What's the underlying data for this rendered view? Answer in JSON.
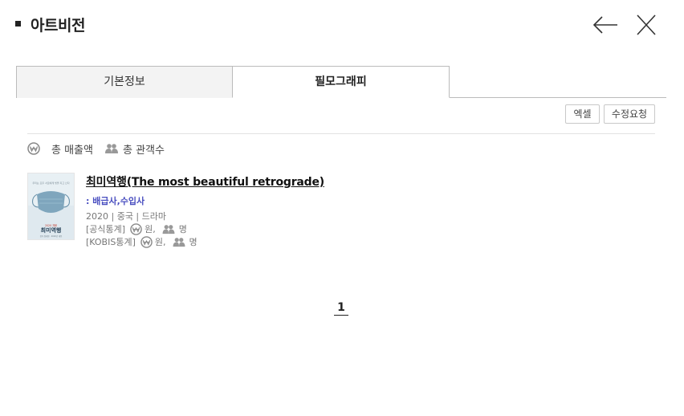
{
  "header": {
    "title": "아트비전"
  },
  "tabs": [
    {
      "label": "기본정보",
      "active": false
    },
    {
      "label": "필모그래피",
      "active": true
    }
  ],
  "toolbar": {
    "excel_label": "엑셀",
    "edit_request_label": "수정요청"
  },
  "summary": {
    "total_sales_label": "총 매출액",
    "total_audience_label": "총 관객수"
  },
  "films": [
    {
      "title": "최미역행(The most beautiful retrograde)",
      "company_role": ": 배급사,수입사",
      "meta": "2020 | 중국 | 드라마",
      "official_label": "[공식통계]",
      "kobis_label": "[KOBIS통계]",
      "won_unit": "원,",
      "people_unit": "명",
      "poster": {
        "top_text": "우리는 모두 서로에게 빚을 지고 산다",
        "title_text": "최미역행",
        "small_text": "2020 개봉",
        "bottom_text": "감독 정대형 · 2020년 개봉"
      }
    }
  ],
  "pagination": {
    "current_page": "1"
  },
  "colors": {
    "accent_company": "#4a4fc0",
    "tab_inactive_bg": "#f3f3f3",
    "border": "#bbbbbb"
  }
}
